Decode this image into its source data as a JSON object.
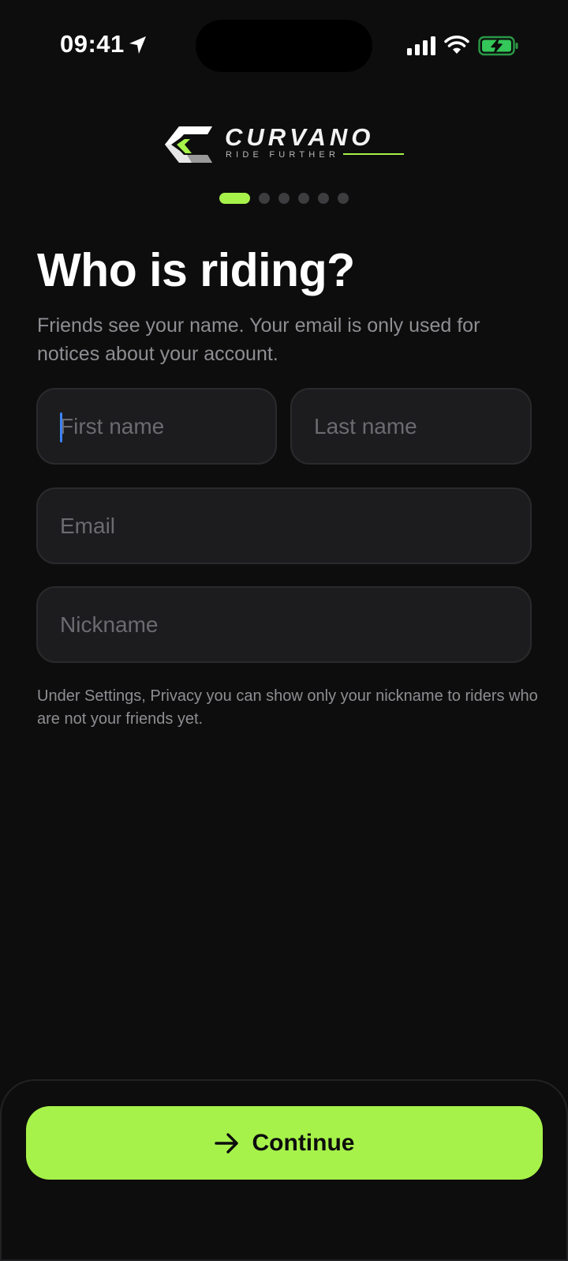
{
  "status_bar": {
    "time": "09:41",
    "icons": [
      "location-arrow-icon",
      "cellular-signal-icon",
      "wifi-icon",
      "battery-charging-icon"
    ]
  },
  "brand": {
    "name": "CURVANO",
    "tagline": "RIDE FURTHER",
    "accent_color": "#a6f24a"
  },
  "progress": {
    "current_step": 1,
    "total_steps": 6
  },
  "page": {
    "title": "Who is riding?",
    "subtitle": "Friends see your name. Your email is only used for notices about your account."
  },
  "form": {
    "first_name": {
      "value": "",
      "placeholder": "First name"
    },
    "last_name": {
      "value": "",
      "placeholder": "Last name"
    },
    "email": {
      "value": "",
      "placeholder": "Email"
    },
    "nickname": {
      "value": "",
      "placeholder": "Nickname"
    },
    "helper_text": "Under Settings, Privacy you can show only your nickname to riders who are not your friends yet."
  },
  "actions": {
    "continue_label": "Continue",
    "continue_icon": "arrow-right-icon"
  },
  "colors": {
    "background": "#0d0d0d",
    "field_background": "#1c1c1e",
    "secondary_text": "#8e8e93",
    "caret": "#3b82f6"
  }
}
